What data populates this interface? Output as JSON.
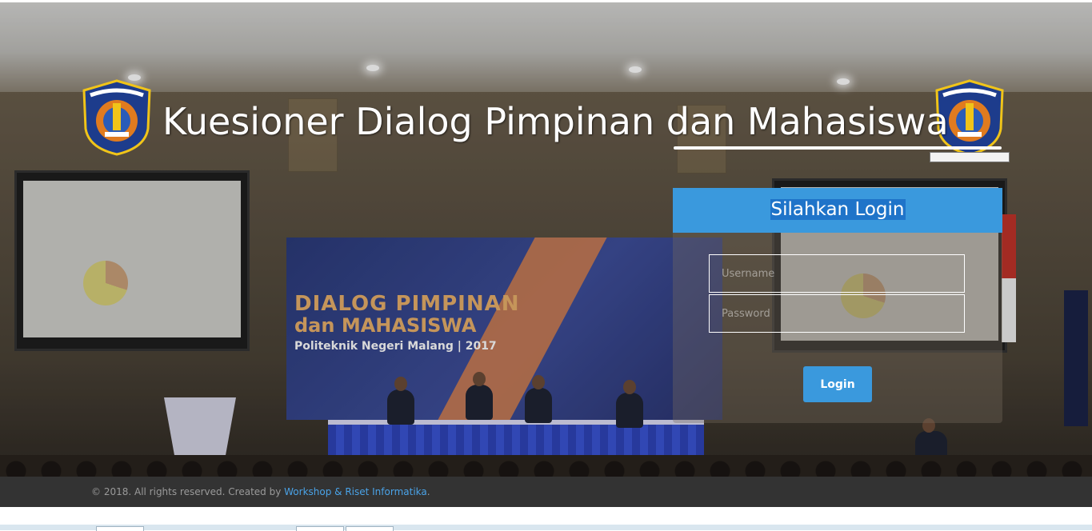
{
  "header": {
    "title": "Kuesioner Dialog Pimpinan dan Mahasiswa",
    "logo_text": "POLITEKNIK NEGERI MALANG"
  },
  "background_banner": {
    "line1": "DIALOG PIMPINAN",
    "line2": "dan MAHASISWA",
    "line3": "Politeknik Negeri Malang | 2017"
  },
  "login": {
    "heading": "Silahkan Login",
    "username_placeholder": "Username",
    "password_placeholder": "Password",
    "button_label": "Login"
  },
  "footer": {
    "text": "© 2018. All rights reserved. Created by ",
    "link_text": "Workshop & Riset Informatika",
    "suffix": "."
  },
  "colors": {
    "accent": "#3a99dd",
    "heading_highlight": "#1f74c9",
    "footer_bg": "#333333",
    "footer_link": "#4aa3e8"
  }
}
